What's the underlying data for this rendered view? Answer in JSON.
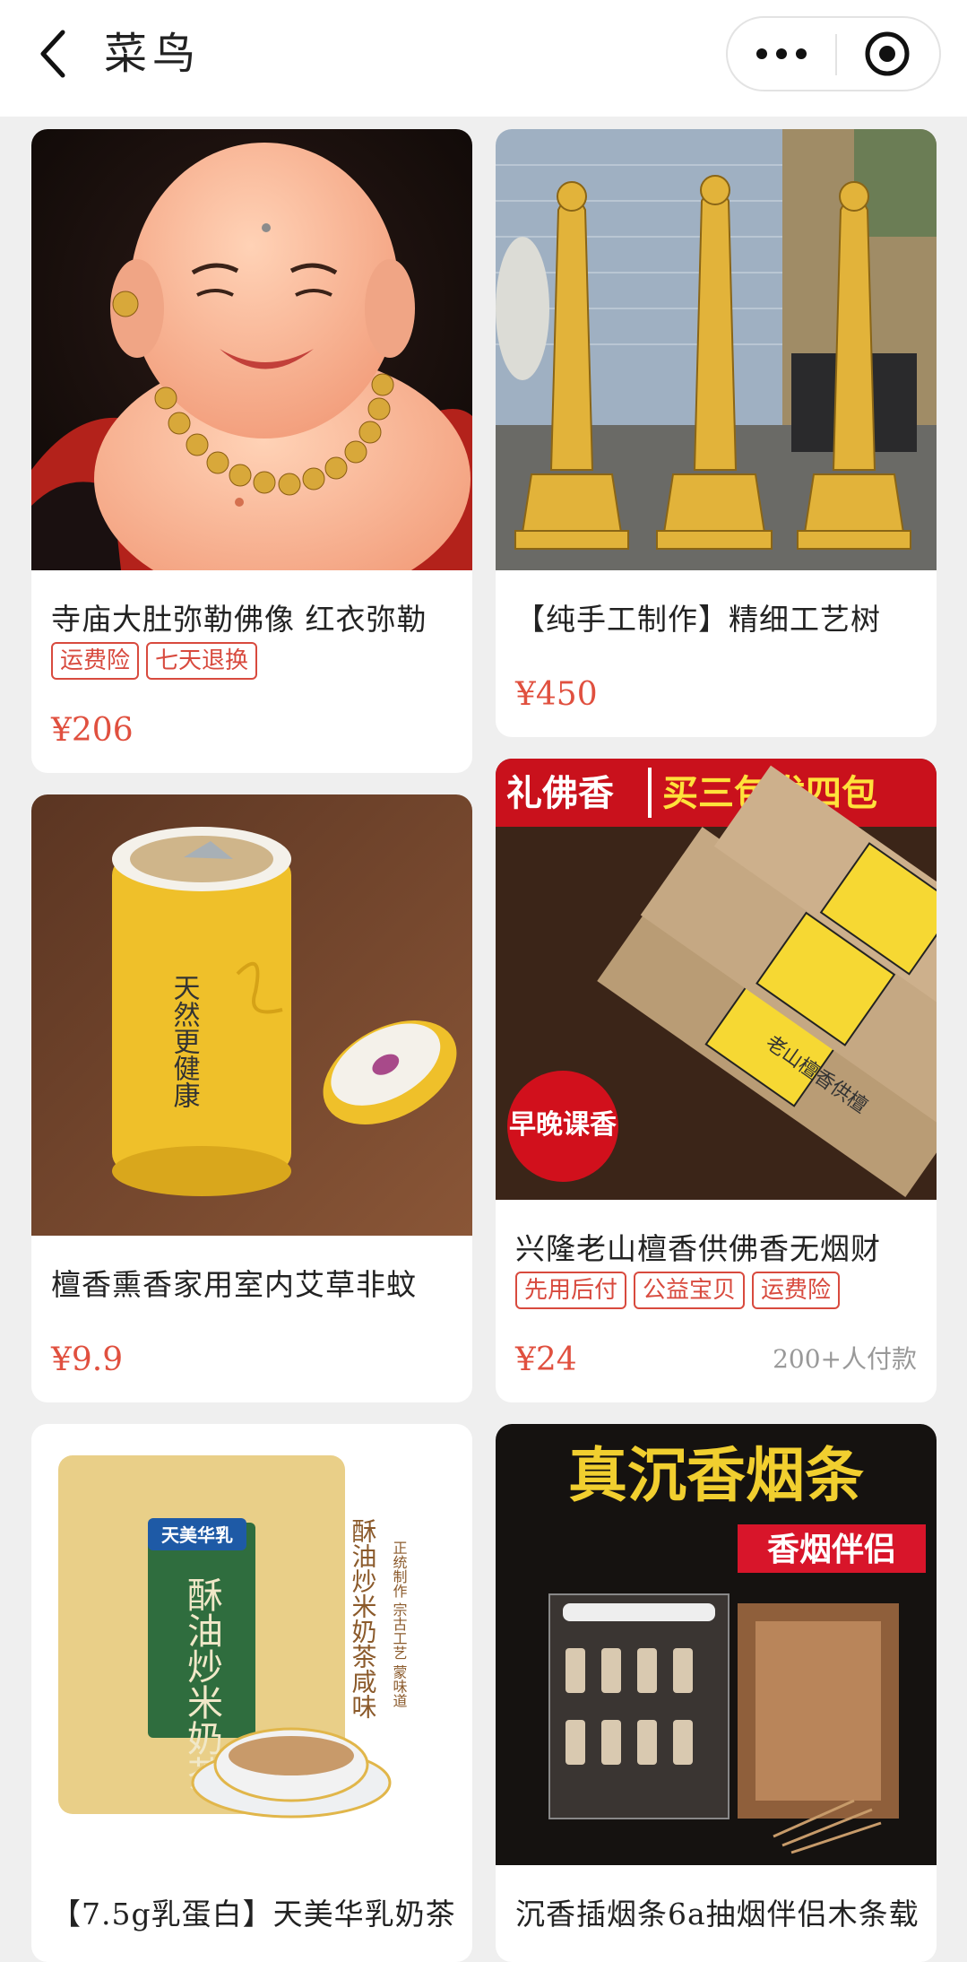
{
  "header": {
    "title": "菜鸟",
    "back_icon": "chevron-left-icon",
    "more_icon": "more-dots-icon",
    "close_icon": "target-close-icon"
  },
  "products": [
    {
      "name": "寺庙大肚弥勒佛像 红衣弥勒",
      "tags": [
        "运费险",
        "七天退换"
      ],
      "price": "¥206",
      "sold": ""
    },
    {
      "name": "【纯手工制作】精细工艺树",
      "tags": [],
      "price": "¥450",
      "sold": ""
    },
    {
      "name": "檀香熏香家用室内艾草非蚊",
      "tags": [],
      "price": "¥9.9",
      "sold": "",
      "image_text": {
        "side": "天然更健康"
      }
    },
    {
      "name": "兴隆老山檀香供佛香无烟财",
      "tags": [
        "先用后付",
        "公益宝贝",
        "运费险"
      ],
      "price": "¥24",
      "sold": "200+人付款",
      "image_text": {
        "banner_left": "礼佛香",
        "banner_right": "买三包发四包",
        "badge": "早晚课香",
        "label": "老山檀香供檀"
      }
    },
    {
      "name": "【7.5g乳蛋白】天美华乳奶茶",
      "tags": [],
      "price": "",
      "sold": "",
      "image_text": {
        "brand": "天美华乳",
        "package": "酥油炒米奶茶",
        "side": "酥油炒米奶茶咸味",
        "side2": "正统制作 宗古工艺 蒙味道"
      }
    },
    {
      "name": "沉香插烟条6a抽烟伴侣木条载",
      "tags": [],
      "price": "",
      "sold": "",
      "image_text": {
        "headline": "真沉香烟条",
        "subline": "香烟伴侣"
      }
    }
  ],
  "colors": {
    "accent": "#e0503f",
    "page_bg": "#efefef",
    "card_bg": "#ffffff"
  }
}
